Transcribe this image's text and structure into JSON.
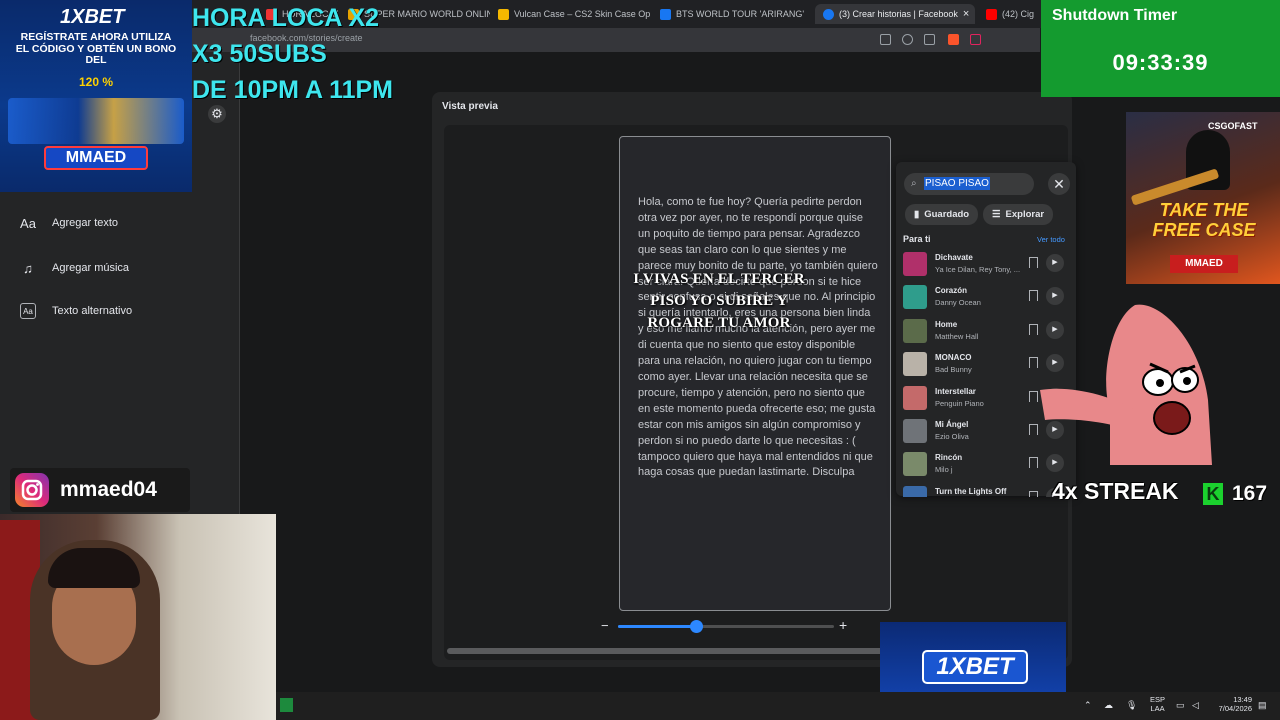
{
  "browser": {
    "tabs": [
      {
        "label": "HORA LOCA X2 ... para ...",
        "active": false
      },
      {
        "label": "SUPER MARIO WORLD ONLINE jueg",
        "active": false
      },
      {
        "label": "Vulcan Case – CS2 Skin Case Openin",
        "active": false
      },
      {
        "label": "BTS WORLD TOUR 'ARIRANG'",
        "active": false
      },
      {
        "label": "(3) Crear historias | Facebook",
        "active": true
      },
      {
        "label": "(42) Cig",
        "active": false
      }
    ],
    "url": "facebook.com/stories/create"
  },
  "sidebar": {
    "items": [
      {
        "icon": "text-icon",
        "glyph": "Aa",
        "label": "Agregar texto"
      },
      {
        "icon": "music-icon",
        "glyph": "♫",
        "label": "Agregar música"
      },
      {
        "icon": "alt-text-icon",
        "glyph": "Aa",
        "label": "Texto alternativo"
      }
    ]
  },
  "preview": {
    "title": "Vista previa",
    "message": "Hola, como te fue hoy? Quería pedirte perdon otra vez por ayer, no te respondí porque quise un poquito de tiempo para pensar. Agradezco que seas tan claro con lo que sientes y me parece muy bonito de tu parte, yo también quiero ser clara. Quería decirte que perdon si te hice sentir confusa o si di señales que no. Al principio si quería intentarlo, eres una persona bien linda y eso me llamo mucho la atención, pero ayer me di cuenta que no siento que estoy disponible para una relación, no quiero jugar con tu tiempo como ayer. Llevar una relación necesita que se procure, tiempo y atención, pero no siento que en este momento pueda ofrecerte eso; me gusta estar con mis amigos sin algún compromiso y perdon si no puedo darte lo que necesitas : ( tampoco quiero que haya mal entendidos ni que haga cosas que puedan lastimarte. Disculpa",
    "overlay_text": "I VIVAS EN EL TERCER PISO YO SUBIRE Y ROGARE TU AMOR",
    "zoom_level": 0.36,
    "zoom_minus": "−",
    "zoom_plus": "+"
  },
  "music": {
    "search_value": "PISAO PISAO",
    "saved_label": "Guardado",
    "explore_label": "Explorar",
    "section_title": "Para ti",
    "see_all": "Ver todo",
    "songs": [
      {
        "title": "Dichavate",
        "artist": "Ya Ice Dilan, Rey Tony, ...",
        "color": "#b0306a"
      },
      {
        "title": "Corazón",
        "artist": "Danny Ocean",
        "color": "#2f9d8c"
      },
      {
        "title": "Home",
        "artist": "Matthew Hall",
        "color": "#5b6b4a"
      },
      {
        "title": "MONACO",
        "artist": "Bad Bunny",
        "color": "#b9b2a8"
      },
      {
        "title": "Interstellar",
        "artist": "Penguin Piano",
        "color": "#c46a6a"
      },
      {
        "title": "Mi Ángel",
        "artist": "Ezio Oliva",
        "color": "#6f7378"
      },
      {
        "title": "Rincón",
        "artist": "Milo j",
        "color": "#7a8a6a"
      },
      {
        "title": "Turn the Lights Off",
        "artist": "",
        "color": "#3a6aa8"
      }
    ]
  },
  "overlays": {
    "ad_top": {
      "brand": "1XBET",
      "text": "REGÍSTRATE AHORA UTILIZA EL CÓDIGO Y OBTÉN UN BONO DEL",
      "bonus": "120 %",
      "code": "MMAED"
    },
    "promo": "HORA LOCA X2\nX3 50SUBS\nDE 10PM A 11PM",
    "timer": {
      "title": "Shutdown Timer",
      "value": "09:33:39"
    },
    "csgo": {
      "brand": "CSGOFAST",
      "headline": "TAKE THE FREE CASE",
      "code": "MMAED"
    },
    "streak": {
      "text": "4x STREAK",
      "badge": "K",
      "count": "167"
    },
    "instagram": {
      "handle": "mmaed04"
    },
    "ad_bottom": {
      "brand": "1XBET"
    }
  },
  "taskbar": {
    "lang_top": "ESP",
    "lang_bottom": "LAA",
    "time": "13:49",
    "date": "7/04/2026"
  },
  "colors": {
    "accent": "#2d88ff",
    "timer_bg": "#149b2f",
    "promo_text": "#3ee6ee"
  }
}
